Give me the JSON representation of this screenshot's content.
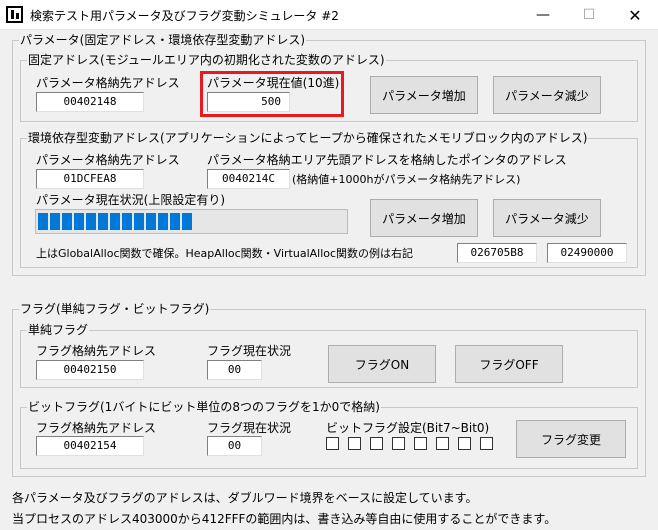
{
  "window": {
    "title": "検索テスト用パラメータ及びフラグ変動シミュレータ #2",
    "minimize": "—",
    "maximize": "☐",
    "close": "✕"
  },
  "param_group": {
    "label": "パラメータ(固定アドレス・環境依存型変動アドレス)",
    "fixed": {
      "label": "固定アドレス(モジュールエリア内の初期化された変数のアドレス)",
      "addr_label": "パラメータ格納先アドレス",
      "addr_value": "00402148",
      "current_label": "パラメータ現在値(10進)",
      "current_value": "500",
      "inc_button": "パラメータ増加",
      "dec_button": "パラメータ減少"
    },
    "env": {
      "label": "環境依存型変動アドレス(アプリケーションによってヒープから確保されたメモリブロック内のアドレス)",
      "addr_label": "パラメータ格納先アドレス",
      "addr_value": "01DCFEA8",
      "ptr_label": "パラメータ格納エリア先頭アドレスを格納したポインタのアドレス",
      "ptr_value": "0040214C",
      "ptr_note": "(格納値+1000hがパラメータ格納先アドレス)",
      "status_label": "パラメータ現在状況(上限設定有り)",
      "progress_segments": 13,
      "inc_button": "パラメータ増加",
      "dec_button": "パラメータ減少",
      "alloc_note": "上はGlobalAlloc関数で確保。HeapAlloc関数・VirtualAlloc関数の例は右記",
      "heap_value": "026705B8",
      "virtual_value": "02490000"
    }
  },
  "flag_group": {
    "label": "フラグ(単純フラグ・ビットフラグ)",
    "simple": {
      "label": "単純フラグ",
      "addr_label": "フラグ格納先アドレス",
      "addr_value": "00402150",
      "status_label": "フラグ現在状況",
      "status_value": "00",
      "on_button": "フラグON",
      "off_button": "フラグOFF"
    },
    "bit": {
      "label": "ビットフラグ(1バイトにビット単位の8つのフラグを1か0で格納)",
      "addr_label": "フラグ格納先アドレス",
      "addr_value": "00402154",
      "status_label": "フラグ現在状況",
      "status_value": "00",
      "setting_label": "ビットフラグ設定(Bit7~Bit0)",
      "change_button": "フラグ変更"
    }
  },
  "footer": {
    "line1": "各パラメータ及びフラグのアドレスは、ダブルワード境界をベースに設定しています。",
    "line2": "当プロセスのアドレス403000から412FFFの範囲内は、書き込み等自由に使用することができます。"
  },
  "colors": {
    "highlight": "#e8191f",
    "progress": "#0078d7"
  }
}
